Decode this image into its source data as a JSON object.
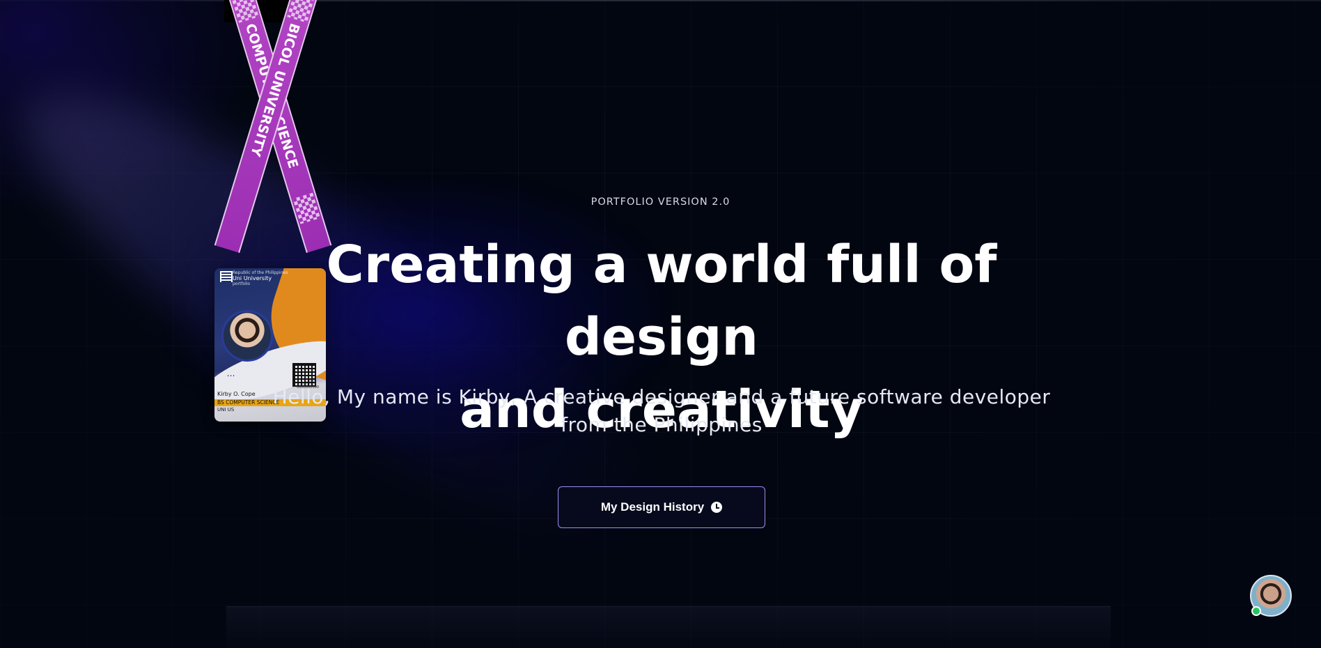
{
  "hero": {
    "eyebrow": "PORTFOLIO VERSION 2.0",
    "title_line1": "Creating a world full of design",
    "title_line2": "and creativity",
    "subtitle_line1": "Hello, My name is Kirby, A creative designer and a future software developer",
    "subtitle_line2": "from the Philippines",
    "cta_label": "My Design History",
    "cta_icon": "clock-icon"
  },
  "lanyard": {
    "left_strap_text": "COMPUTER SCIENCE",
    "right_strap_text": "BICOL UNIVERSITY"
  },
  "id_card": {
    "org_line1": "Republic of the Philippines",
    "org_line2": "Uni University",
    "org_line3": "portfolio",
    "signature": "…",
    "qr_id": "0000000000",
    "name": "Kirby O. Cope",
    "course": "BS COMPUTER SCIENCE",
    "university": "UNI US"
  },
  "chat": {
    "status": "online",
    "status_color": "#22c55e"
  },
  "colors": {
    "background": "#020611",
    "accent_border": "#9a8ef0",
    "lanyard_purple": "#a63bbd",
    "card_orange": "#e08a1e"
  }
}
